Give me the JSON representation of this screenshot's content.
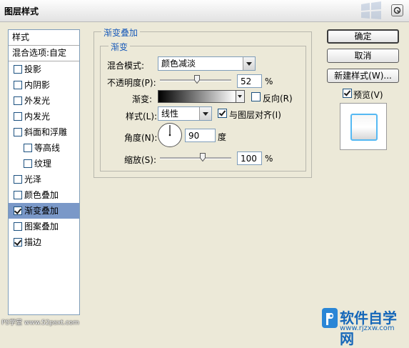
{
  "window": {
    "title": "图层样式"
  },
  "sidebar": {
    "header": "样式",
    "blend_options": "混合选项:自定",
    "items": [
      {
        "label": "投影",
        "checked": false,
        "sub": false
      },
      {
        "label": "内阴影",
        "checked": false,
        "sub": false
      },
      {
        "label": "外发光",
        "checked": false,
        "sub": false
      },
      {
        "label": "内发光",
        "checked": false,
        "sub": false
      },
      {
        "label": "斜面和浮雕",
        "checked": false,
        "sub": false
      },
      {
        "label": "等高线",
        "checked": false,
        "sub": true
      },
      {
        "label": "纹理",
        "checked": false,
        "sub": true
      },
      {
        "label": "光泽",
        "checked": false,
        "sub": false
      },
      {
        "label": "颜色叠加",
        "checked": false,
        "sub": false
      },
      {
        "label": "渐变叠加",
        "checked": true,
        "sub": false,
        "selected": true
      },
      {
        "label": "图案叠加",
        "checked": false,
        "sub": false
      },
      {
        "label": "描边",
        "checked": true,
        "sub": false
      }
    ]
  },
  "panel": {
    "outer_title": "渐变叠加",
    "inner_title": "渐变",
    "blend_mode_label": "混合模式:",
    "blend_mode_value": "颜色减淡",
    "opacity_label": "不透明度(P):",
    "opacity_value": "52",
    "opacity_unit": "%",
    "opacity_fraction": 0.52,
    "gradient_label": "渐变:",
    "reverse_label": "反向(R)",
    "reverse_checked": false,
    "style_label": "样式(L):",
    "style_value": "线性",
    "align_label": "与图层对齐(I)",
    "align_checked": true,
    "angle_label": "角度(N):",
    "angle_value": "90",
    "angle_unit": "度",
    "scale_label": "缩放(S):",
    "scale_value": "100",
    "scale_unit": "%"
  },
  "buttons": {
    "ok": "确定",
    "cancel": "取消",
    "new_style": "新建样式(W)...",
    "preview_label": "预览(V)",
    "preview_checked": true
  },
  "watermarks": {
    "left": "PS学堂 www.52psxt.com",
    "right_title": "软件自学网",
    "right_url": "www.rjzxw.com"
  },
  "colors": {
    "accent": "#1a5bb9",
    "selection": "#7a98c8",
    "preview_border": "#55b9f3"
  }
}
